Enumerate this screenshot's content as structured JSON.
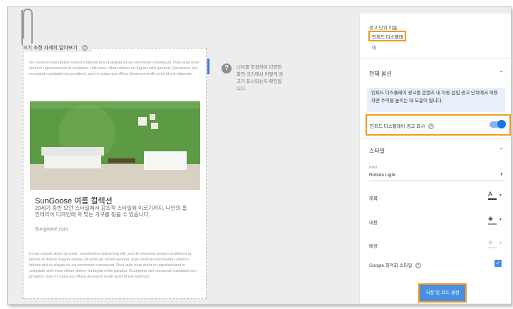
{
  "preview": {
    "header": "크기 조정 자세히 알아보기",
    "lorem_top": "uis nostrud exercitation ullamco laboris nisi ut aliquip ex ea commodo consequat. Duis aute irure dolor in reprehenderit in voluptate velit esse cillum dolore eu fugiat nulla pariatur. Excepteur sint occaecat cupidatat non proident, sunt in culpa qui officia deserunt mollit anim id est laborum.",
    "ad_title": "SunGoose 여름 컬렉션",
    "ad_description": "20세기 중반 모던 스타일에서 감조적 스타일에 이르기까지, 나만의 홈 인테리어 디자인에 꼭 맞는 가구를 찾을 수 있습니다.",
    "ad_url": "Sungoose.com",
    "lorem_bottom": "Lorem ipsum dolor sit amet, consectetur adipiscing elit, sed do eiusmod tempor incididunt ut labore et dolore magna aliqua. Ut enim ad minim veniam, quis nostrud exercitation ullamco laboris nisi ut aliquip ex ea commodo consequat. Duis aute irure dolor in reprehenderit in voluptate velit esse cillum dolore eu fugiat nulla pariatur. Excepteur sint occaecat cupidatat non proident, sunt in culpa qui officia deserunt mollit anim id est laborum."
  },
  "help": {
    "text": "너비를 조정하여 다양한 화면 크기에서 어떻게 광고가 표시되는지 확인합니다."
  },
  "panel": {
    "ad_unit_label": "광고 단위 이름",
    "ad_unit_value": "인피드 디스플레이",
    "global_options": {
      "title": "전체 옵션",
      "info": "인피드 디스플레이 광고를 콘텐츠 내 자동 삽입 광고 단위에서 허용하면 수익을 높이는 데 도움이 됩니다.",
      "toggle_label": "인피드 디스플레이 광고 표시",
      "toggle_on": true
    },
    "style": {
      "title": "스타일",
      "font_label": "Font",
      "font_value": "Roboto Light",
      "title_row": "제목",
      "body_row": "내용",
      "background_row": "배경",
      "google_style": "Google 최적화 스타일",
      "google_style_checked": true
    },
    "save_button": "저장 및 코드 생성"
  },
  "colors": {
    "accent": "#1a73e8",
    "highlight": "#f29c1f",
    "info_bg": "#e8eefa"
  }
}
